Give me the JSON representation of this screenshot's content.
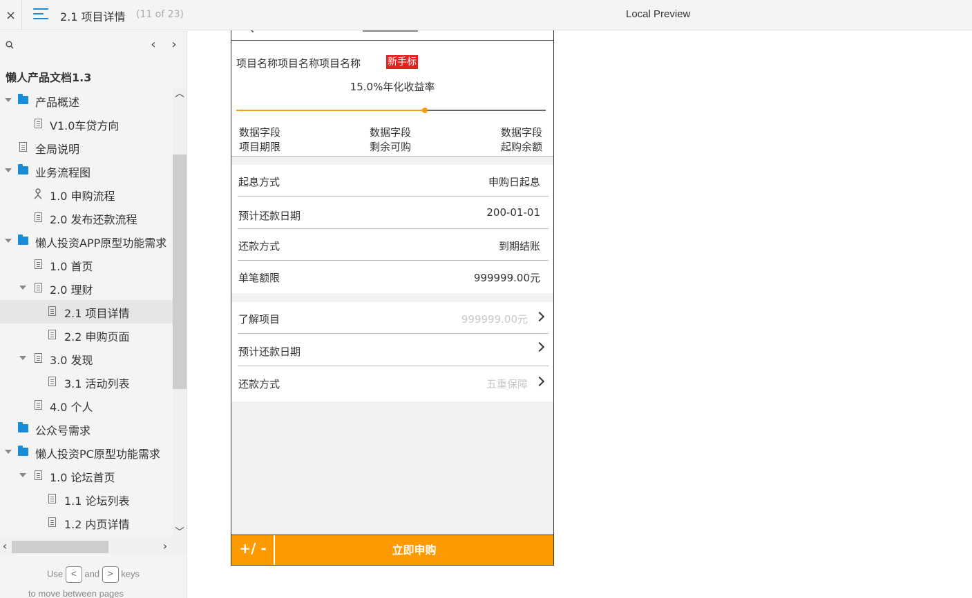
{
  "topbar": {
    "close_label": "×",
    "title": "2.1 项目详情",
    "page_count": "(11 of 23)",
    "preview_label": "Local Preview"
  },
  "sidebar": {
    "doc_title": "懒人产品文档1.3",
    "nav_prev": "‹",
    "nav_next": "›",
    "items": [
      {
        "label": "产品概述",
        "type": "folder"
      },
      {
        "label": "V1.0车贷方向",
        "type": "page"
      },
      {
        "label": "全局说明",
        "type": "page"
      },
      {
        "label": "业务流程图",
        "type": "folder"
      },
      {
        "label": "1.0 申购流程",
        "type": "flow"
      },
      {
        "label": "2.0 发布还款流程",
        "type": "page"
      },
      {
        "label": "懒人投资APP原型功能需求",
        "type": "folder"
      },
      {
        "label": "1.0 首页",
        "type": "page"
      },
      {
        "label": "2.0 理财",
        "type": "page"
      },
      {
        "label": "2.1 项目详情",
        "type": "page"
      },
      {
        "label": "2.2 申购页面",
        "type": "page"
      },
      {
        "label": "3.0 发现",
        "type": "page"
      },
      {
        "label": "3.1 活动列表",
        "type": "page"
      },
      {
        "label": "4.0 个人",
        "type": "page"
      },
      {
        "label": "公众号需求",
        "type": "folder"
      },
      {
        "label": "懒人投资PC原型功能需求",
        "type": "folder"
      },
      {
        "label": "1.0 论坛首页",
        "type": "page"
      },
      {
        "label": "1.1 论坛列表",
        "type": "page"
      },
      {
        "label": "1.2 内页详情",
        "type": "page"
      }
    ],
    "hint": {
      "use": "Use",
      "key_prev": "<",
      "and": "and",
      "key_next": ">",
      "keys": "keys",
      "line2": "to move between pages"
    }
  },
  "phone": {
    "project_name": "项目名称项目名称项目名称",
    "badge": "新手标",
    "rate": "15.0%年化收益率",
    "progress_fraction": 0.61,
    "stats": [
      {
        "value": "数据字段",
        "label": "项目期限"
      },
      {
        "value": "数据字段",
        "label": "剩余可购"
      },
      {
        "value": "数据字段",
        "label": "起购余额"
      }
    ],
    "details": [
      {
        "key": "起息方式",
        "value": "申购日起息"
      },
      {
        "key": "预计还款日期",
        "value": "200-01-01"
      },
      {
        "key": "还款方式",
        "value": "到期结账"
      },
      {
        "key": "单笔额限",
        "value": "999999.00元"
      }
    ],
    "links": [
      {
        "key": "了解项目",
        "value": "999999.00元"
      },
      {
        "key": "预计还款日期",
        "value": ""
      },
      {
        "key": "还款方式",
        "value": "五重保障"
      }
    ],
    "qty_label": "+/ -",
    "buy_label": "立即申购",
    "accent_color": "#fd9a00",
    "badge_color": "#e61f1f"
  }
}
